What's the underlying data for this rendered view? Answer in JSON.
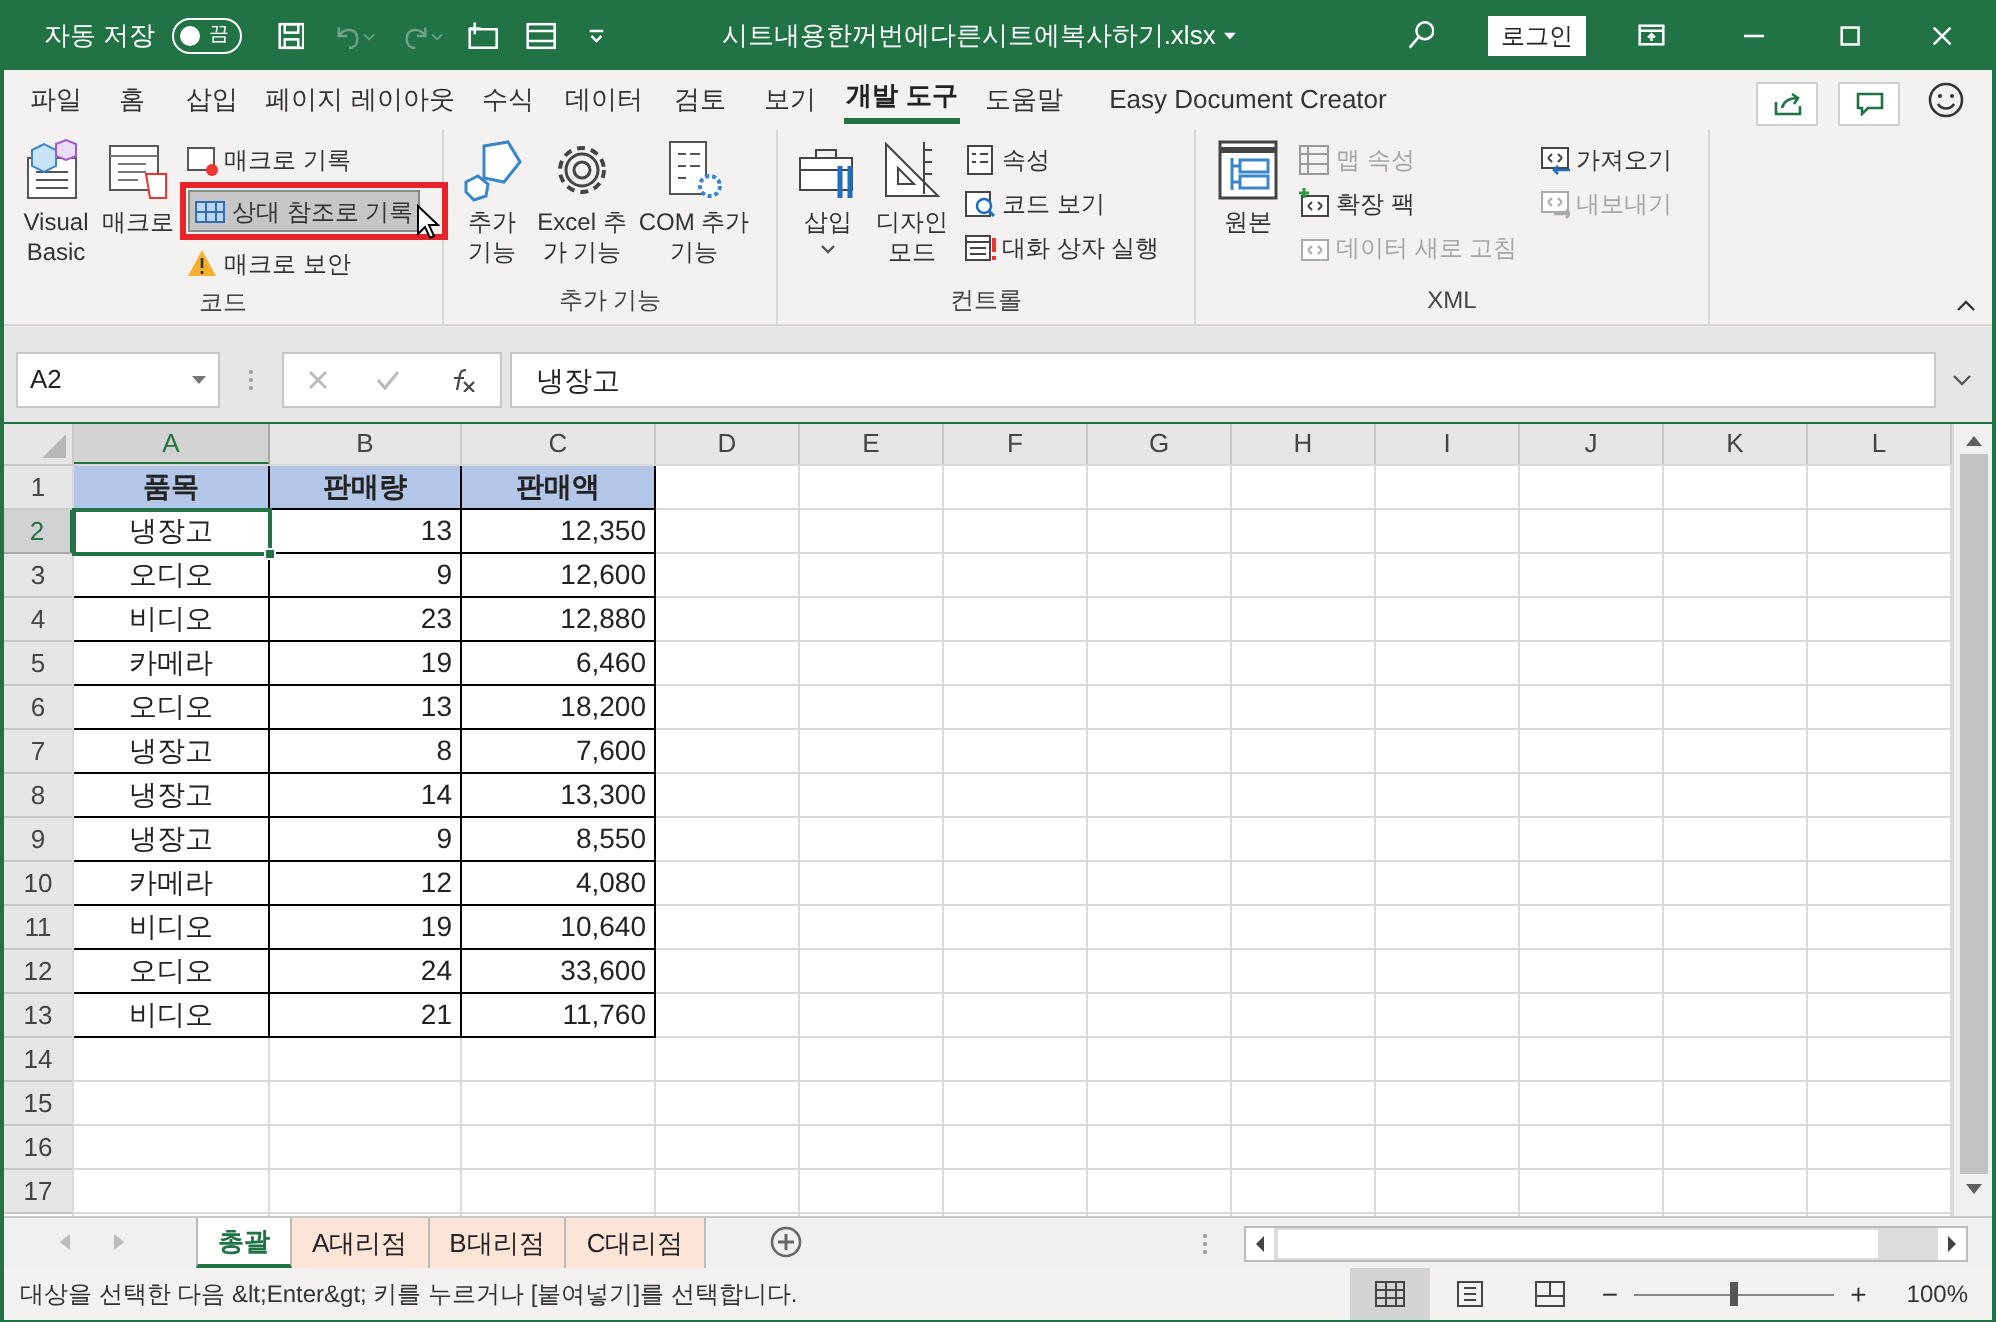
{
  "title_bar": {
    "autosave_label": "자동 저장",
    "autosave": {
      "on": false,
      "label": "끔"
    },
    "filename": "시트내용한꺼번에다른시트에복사하기.xlsx",
    "login": "로그인"
  },
  "ribbon_tabs": [
    {
      "label": "파일",
      "selected": false
    },
    {
      "label": "홈",
      "selected": false
    },
    {
      "label": "삽입",
      "selected": false
    },
    {
      "label": "페이지 레이아웃",
      "selected": false
    },
    {
      "label": "수식",
      "selected": false
    },
    {
      "label": "데이터",
      "selected": false
    },
    {
      "label": "검토",
      "selected": false
    },
    {
      "label": "보기",
      "selected": false
    },
    {
      "label": "개발 도구",
      "selected": true
    },
    {
      "label": "도움말",
      "selected": false
    },
    {
      "label": "Easy Document Creator",
      "selected": false
    }
  ],
  "ribbon_groups": [
    {
      "label": "코드",
      "large": [
        {
          "label": "Visual Basic"
        },
        {
          "label": "매크로"
        }
      ],
      "small_columns": [
        [
          {
            "label": "매크로 기록",
            "disabled": false,
            "highlighted": false
          },
          {
            "label": "상대 참조로 기록",
            "disabled": false,
            "highlighted": true
          },
          {
            "label": "매크로 보안",
            "disabled": false,
            "highlighted": false
          }
        ]
      ]
    },
    {
      "label": "추가 기능",
      "large": [
        {
          "label": "추가 기능"
        },
        {
          "label": "Excel 추가 기능"
        },
        {
          "label": "COM 추가 기능"
        }
      ]
    },
    {
      "label": "컨트롤",
      "large": [
        {
          "label": "삽입"
        },
        {
          "label": "디자인 모드"
        }
      ],
      "small_columns": [
        [
          {
            "label": "속성",
            "disabled": false,
            "highlighted": false
          },
          {
            "label": "코드 보기",
            "disabled": false,
            "highlighted": false
          },
          {
            "label": "대화 상자 실행",
            "disabled": false,
            "highlighted": false
          }
        ]
      ]
    },
    {
      "label": "XML",
      "large": [
        {
          "label": "원본"
        }
      ],
      "small_columns": [
        [
          {
            "label": "맵 속성",
            "disabled": true,
            "highlighted": false
          },
          {
            "label": "확장 팩",
            "disabled": false,
            "highlighted": false
          },
          {
            "label": "데이터 새로 고침",
            "disabled": true,
            "highlighted": false
          }
        ],
        [
          {
            "label": "가져오기",
            "disabled": false,
            "highlighted": false
          },
          {
            "label": "내보내기",
            "disabled": true,
            "highlighted": false
          }
        ]
      ]
    }
  ],
  "formula_bar": {
    "name_box": "A2",
    "formula": "냉장고"
  },
  "columns": [
    {
      "label": "A",
      "selected": true
    },
    {
      "label": "B",
      "selected": false
    },
    {
      "label": "C",
      "selected": false
    },
    {
      "label": "D",
      "selected": false
    },
    {
      "label": "E",
      "selected": false
    },
    {
      "label": "F",
      "selected": false
    },
    {
      "label": "G",
      "selected": false
    },
    {
      "label": "H",
      "selected": false
    },
    {
      "label": "I",
      "selected": false
    },
    {
      "label": "J",
      "selected": false
    },
    {
      "label": "K",
      "selected": false
    },
    {
      "label": "L",
      "selected": false
    }
  ],
  "rows": [
    {
      "header": "1",
      "kind": "header",
      "selected": false,
      "cells": [
        "품목",
        "판매량",
        "판매액"
      ]
    },
    {
      "header": "2",
      "kind": "data",
      "selected": true,
      "cells": [
        "냉장고",
        "13",
        "12,350"
      ]
    },
    {
      "header": "3",
      "kind": "data",
      "selected": false,
      "cells": [
        "오디오",
        "9",
        "12,600"
      ]
    },
    {
      "header": "4",
      "kind": "data",
      "selected": false,
      "cells": [
        "비디오",
        "23",
        "12,880"
      ]
    },
    {
      "header": "5",
      "kind": "data",
      "selected": false,
      "cells": [
        "카메라",
        "19",
        "6,460"
      ]
    },
    {
      "header": "6",
      "kind": "data",
      "selected": false,
      "cells": [
        "오디오",
        "13",
        "18,200"
      ]
    },
    {
      "header": "7",
      "kind": "data",
      "selected": false,
      "cells": [
        "냉장고",
        "8",
        "7,600"
      ]
    },
    {
      "header": "8",
      "kind": "data",
      "selected": false,
      "cells": [
        "냉장고",
        "14",
        "13,300"
      ]
    },
    {
      "header": "9",
      "kind": "data",
      "selected": false,
      "cells": [
        "냉장고",
        "9",
        "8,550"
      ]
    },
    {
      "header": "10",
      "kind": "data",
      "selected": false,
      "cells": [
        "카메라",
        "12",
        "4,080"
      ]
    },
    {
      "header": "11",
      "kind": "data",
      "selected": false,
      "cells": [
        "비디오",
        "19",
        "10,640"
      ]
    },
    {
      "header": "12",
      "kind": "data",
      "selected": false,
      "cells": [
        "오디오",
        "24",
        "33,600"
      ]
    },
    {
      "header": "13",
      "kind": "data",
      "selected": false,
      "cells": [
        "비디오",
        "21",
        "11,760"
      ]
    },
    {
      "header": "14",
      "kind": "empty",
      "selected": false
    },
    {
      "header": "15",
      "kind": "empty",
      "selected": false
    },
    {
      "header": "16",
      "kind": "empty",
      "selected": false
    },
    {
      "header": "17",
      "kind": "empty",
      "selected": false
    }
  ],
  "sheet_tabs": [
    {
      "label": "총괄",
      "selected": true,
      "color": "#ffffff"
    },
    {
      "label": "A대리점",
      "selected": false,
      "color": "#fce4d6"
    },
    {
      "label": "B대리점",
      "selected": false,
      "color": "#fce4d6"
    },
    {
      "label": "C대리점",
      "selected": false,
      "color": "#fce4d6"
    }
  ],
  "status_bar": {
    "message": "대상을 선택한 다음 &lt;Enter&gt; 키를 누르거나 [붙여넣기]를 선택합니다.",
    "views": [
      {
        "selected": true
      },
      {
        "selected": false
      },
      {
        "selected": false
      }
    ],
    "zoom_minus": "−",
    "zoom_plus": "+",
    "zoom_slider": {
      "level": 0.5
    },
    "zoom": "100%"
  }
}
